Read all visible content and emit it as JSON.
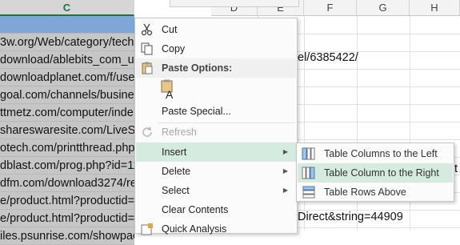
{
  "columns": [
    "C",
    "D",
    "E",
    "F",
    "G",
    "H"
  ],
  "column_c_cells": [
    "3w.org/Web/category/tech",
    "download/ablebits_com_u",
    "downloadplanet.com/f/use",
    "goal.com/channels/busine",
    "ttmetz.com/computer/inde",
    "shareswaresite.com/LiveSit",
    "otech.com/printthread.php",
    "dblast.com/prog.php?id=11",
    "dfm.com/download3274/re",
    "e/product.html?productid=",
    "e/product.html?productid=",
    "iles.psunrise.com/showpac"
  ],
  "overflow_texts": {
    "row2": "el/6385422/",
    "row9": "t",
    "row12": "Direct&string=44909"
  },
  "context_menu": {
    "cut": "Cut",
    "copy": "Copy",
    "paste_options": "Paste Options:",
    "paste_special": "Paste Special...",
    "refresh": "Refresh",
    "insert": "Insert",
    "delete": "Delete",
    "select": "Select",
    "clear_contents": "Clear Contents",
    "quick_analysis": "Quick Analysis"
  },
  "insert_submenu": {
    "columns_left": "Table Columns to the Left",
    "column_right": "Table Column to the Right",
    "rows_above": "Table Rows Above"
  },
  "colors": {
    "selection": "#7ea6d6",
    "hover": "#d5ebdf",
    "excel_green": "#217346"
  }
}
